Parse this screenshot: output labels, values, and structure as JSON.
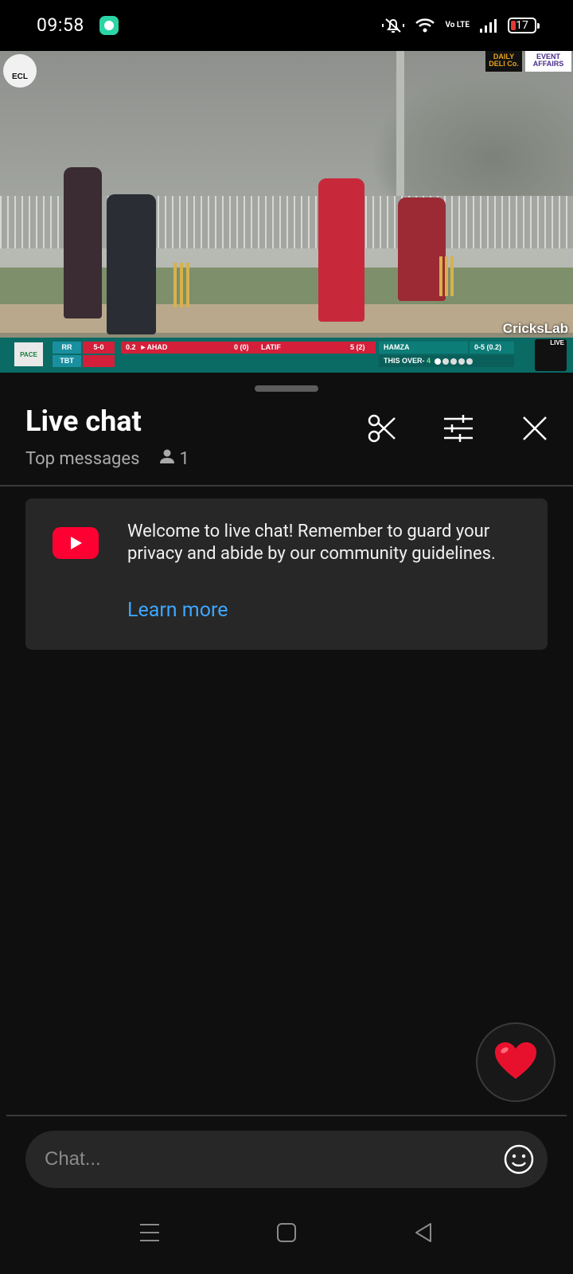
{
  "status_bar": {
    "time": "09:58",
    "network": "Vo LTE",
    "battery": "17"
  },
  "video": {
    "league_logo": "ECL",
    "sponsor_1": "DAILY DELI Co.",
    "sponsor_2": "EVENT AFFAIRS",
    "watermark": "CricksLab",
    "scoreboard": {
      "team_1": "RR",
      "team_1_score": "5-0",
      "team_2": "TBT",
      "overs": "0.2",
      "batter_1": "AHAD",
      "batter_1_score": "0",
      "batter_1_balls": "(0)",
      "batter_2": "LATIF",
      "batter_2_score": "5",
      "batter_2_balls": "(2)",
      "bowler": "HAMZA",
      "bowler_figures": "0-5",
      "bowler_overs": "(0.2)",
      "this_over_label": "THIS OVER-",
      "this_over_runs": "4",
      "live_label": "LIVE"
    }
  },
  "chat": {
    "title": "Live chat",
    "mode": "Top messages",
    "viewer_count": "1",
    "welcome_message": "Welcome to live chat! Remember to guard your privacy and abide by our community guidelines.",
    "learn_more": "Learn more",
    "input_placeholder": "Chat...",
    "heart_emoji": "❤️"
  },
  "colors": {
    "background": "#0f0f0f",
    "card": "#272727",
    "link": "#3ea6ff",
    "youtube_red": "#ff0033"
  },
  "icons": {
    "header": [
      "scissors-icon",
      "filter-sliders-icon",
      "close-icon"
    ],
    "nav": [
      "recents-icon",
      "home-icon",
      "back-icon"
    ]
  }
}
